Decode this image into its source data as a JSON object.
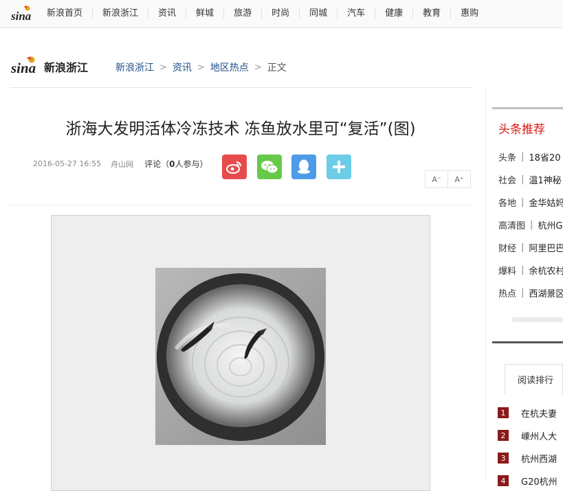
{
  "topnav": {
    "logo": "sina",
    "items": [
      "新浪首页",
      "新浪浙江",
      "资讯",
      "鲜城",
      "旅游",
      "时尚",
      "同城",
      "汽车",
      "健康",
      "教育",
      "惠购"
    ]
  },
  "brand": {
    "logo": "sina",
    "name": "新浪浙江"
  },
  "breadcrumb": {
    "items": [
      "新浪浙江",
      "资讯",
      "地区热点"
    ],
    "separator": ">",
    "current": "正文"
  },
  "article": {
    "title": "浙海大发明活体冷冻技术 冻鱼放水里可“复活”(图)",
    "date": "2016-05-27 16:55",
    "source": "舟山网",
    "comment_label": "评论（",
    "comment_count": "0",
    "comment_suffix": "人参与）",
    "font_smaller": "A⁻",
    "font_larger": "A⁺"
  },
  "share": [
    {
      "icon": "weibo-icon",
      "color": "#e74c4c"
    },
    {
      "icon": "wechat-icon",
      "color": "#67c94a"
    },
    {
      "icon": "qq-icon",
      "color": "#4e9be8"
    },
    {
      "icon": "plus-icon",
      "color": "#6ccde8"
    }
  ],
  "sidebar": {
    "title": "头条推荐",
    "items": [
      {
        "cat": "头条",
        "text": "18省20"
      },
      {
        "cat": "社会",
        "text": "温1神秘"
      },
      {
        "cat": "各地",
        "text": "金华姑妈"
      },
      {
        "cat": "高清图",
        "text": "杭州G"
      },
      {
        "cat": "财经",
        "text": "阿里巴巴"
      },
      {
        "cat": "爆料",
        "text": "余杭农村"
      },
      {
        "cat": "热点",
        "text": "西湖景区"
      }
    ],
    "rank_tab": "阅读排行",
    "rank": [
      {
        "n": "1",
        "text": "在杭夫妻"
      },
      {
        "n": "2",
        "text": "嵊州人大"
      },
      {
        "n": "3",
        "text": "杭州西湖"
      },
      {
        "n": "4",
        "text": "G20杭州"
      }
    ]
  },
  "colors": {
    "accent_red": "#d9190e",
    "link_blue": "#1f4f8a",
    "rank_red": "#8b1a1a"
  }
}
